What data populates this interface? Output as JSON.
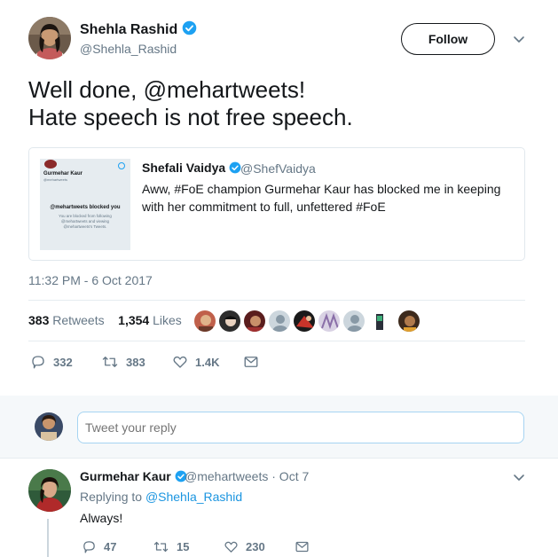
{
  "tweet": {
    "author_name": "Shehla Rashid",
    "author_handle": "@Shehla_Rashid",
    "follow_label": "Follow",
    "text_lines": [
      "Well done, @mehartweets!",
      "Hate speech is not free speech."
    ],
    "timestamp": "11:32 PM - 6 Oct 2017",
    "retweets_count": "383",
    "retweets_label": "Retweets",
    "likes_count": "1,354",
    "likes_label": "Likes",
    "actions": {
      "reply_count": "332",
      "retweet_count": "383",
      "like_count": "1.4K"
    },
    "quote": {
      "name": "Shefali Vaidya",
      "handle": "@ShefVaidya",
      "text": "Aww, #FoE champion Gurmehar Kaur has blocked me in keeping with her commitment to full, unfettered #FoE",
      "thumbnail": {
        "name": "Gurmehar Kaur",
        "handle": "@mehartweets",
        "blocked_title": "@mehartweets blocked you",
        "blocked_desc": "You are blocked from following @mehartweets and viewing @mehartweets's Tweets."
      }
    },
    "liker_icons": [
      "liker-avatar",
      "liker-avatar",
      "liker-avatar",
      "default-avatar-icon",
      "liker-avatar",
      "liker-avatar",
      "default-avatar-icon",
      "liker-avatar",
      "liker-avatar"
    ]
  },
  "reply_box": {
    "placeholder": "Tweet your reply"
  },
  "comment": {
    "name": "Gurmehar Kaur",
    "meta": "@mehartweets · Oct 7",
    "replying_prefix": "Replying to",
    "replying_handle": "@Shehla_Rashid",
    "text": "Always!",
    "actions": {
      "reply_count": "47",
      "retweet_count": "15",
      "like_count": "230"
    }
  },
  "colors": {
    "verified": "#1da1f2",
    "link": "#1b95e0",
    "secondary_text": "#657786",
    "band_bg": "#f5f8fa"
  }
}
